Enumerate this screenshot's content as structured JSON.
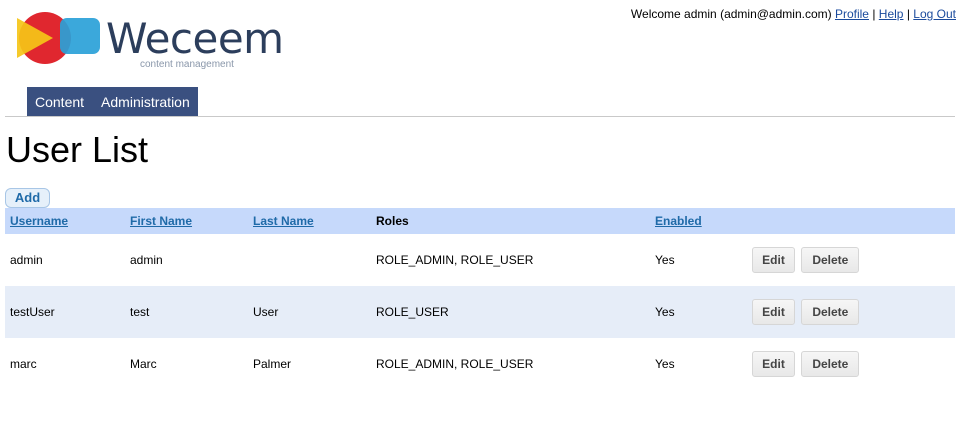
{
  "brand": {
    "name": "Weceem",
    "tagline": "content management",
    "colors": {
      "red": "#e0272f",
      "yellow": "#f5c518",
      "blue": "#2aa1d8",
      "text": "#2c3e5c"
    }
  },
  "userbar": {
    "welcome": "Welcome admin (admin@admin.com)",
    "profile": "Profile",
    "help": "Help",
    "logout": "Log Out",
    "separator": "|"
  },
  "nav": {
    "items": [
      {
        "label": "Content"
      },
      {
        "label": "Administration"
      }
    ]
  },
  "page": {
    "title": "User List",
    "add_label": "Add"
  },
  "table": {
    "headers": {
      "username": "Username",
      "first_name": "First Name",
      "last_name": "Last Name",
      "roles": "Roles",
      "enabled": "Enabled"
    },
    "rows": [
      {
        "username": "admin",
        "first_name": "admin",
        "last_name": "",
        "roles": "ROLE_ADMIN, ROLE_USER",
        "enabled": "Yes"
      },
      {
        "username": "testUser",
        "first_name": "test",
        "last_name": "User",
        "roles": "ROLE_USER",
        "enabled": "Yes"
      },
      {
        "username": "marc",
        "first_name": "Marc",
        "last_name": "Palmer",
        "roles": "ROLE_ADMIN, ROLE_USER",
        "enabled": "Yes"
      }
    ],
    "edit_label": "Edit",
    "delete_label": "Delete"
  }
}
